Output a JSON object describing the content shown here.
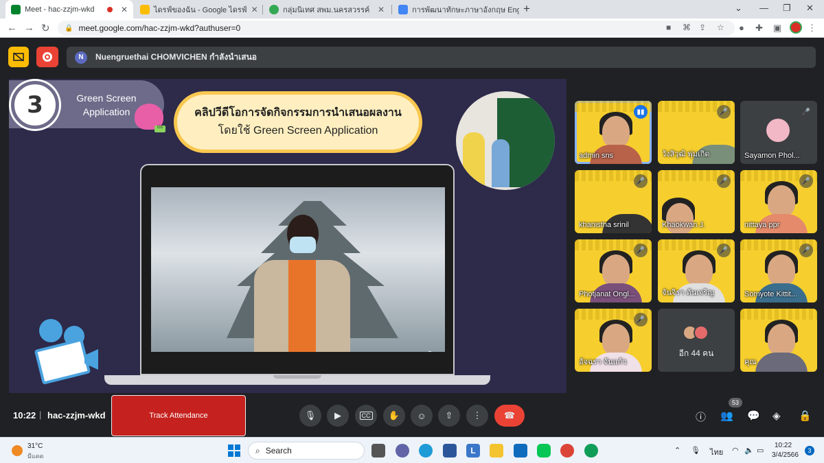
{
  "browser": {
    "tabs": [
      {
        "label": "Meet - hac-zzjm-wkd",
        "color": "#00832d"
      },
      {
        "label": "ไดรฟ์ของฉัน - Google ไดรฟ์",
        "color": "#fbbc04"
      },
      {
        "label": "กลุ่มนิเทศ สพม.นครสวรรค์",
        "color": "#34a853"
      },
      {
        "label": "การพัฒนาทักษะภาษาอังกฤษ English",
        "color": "#4285f4"
      }
    ],
    "url": "meet.google.com/hac-zzjm-wkd?authuser=0"
  },
  "meet": {
    "presenter_avatar": "N",
    "presenter_text": "Nuengruethai CHOMVICHEN กำลังนำเสนอ",
    "slide": {
      "step_number": "3",
      "step_text": "Green Screen Application",
      "title_line1": "คลิปวีดีโอการจัดกิจกรรมการนำเสนอผลงาน",
      "title_line2": "โดยใช้ Green Screen Application",
      "octo_badge": "G5"
    },
    "participants": [
      {
        "name": "admin sns",
        "style": "yellow",
        "speaking": true
      },
      {
        "name": "วังสิวุฒิ พุ่มเกิด",
        "style": "yellow",
        "speaking": false
      },
      {
        "name": "Sayamon Phol...",
        "style": "dark",
        "speaking": false
      },
      {
        "name": "khanistha srinil",
        "style": "yellow",
        "speaking": false
      },
      {
        "name": "Khaokwan J.",
        "style": "yellow",
        "speaking": false
      },
      {
        "name": "nittaya ppr",
        "style": "yellow",
        "speaking": false
      },
      {
        "name": "Photjanat Ongl...",
        "style": "yellow",
        "speaking": false
      },
      {
        "name": "จันจิรา ต้นเจริญ",
        "style": "yellow",
        "speaking": false
      },
      {
        "name": "Somyote Kittit...",
        "style": "yellow",
        "speaking": false
      },
      {
        "name": "อัจฉรา จันแก้ว",
        "style": "yellow",
        "speaking": false
      },
      {
        "name": "อีก 44 คน",
        "style": "more",
        "speaking": false
      },
      {
        "name": "คุณ",
        "style": "yellow",
        "speaking": false
      }
    ],
    "time": "10:22",
    "separator": "|",
    "code": "hac-zzjm-wkd",
    "track_attendance": "Track Attendance",
    "people_count": "53"
  },
  "taskbar": {
    "temperature": "31°C",
    "condition": "มีแดด",
    "search_label": "Search",
    "language": "ไทย",
    "clock_time": "10:22",
    "clock_date": "3/4/2566",
    "notification_count": "3"
  }
}
